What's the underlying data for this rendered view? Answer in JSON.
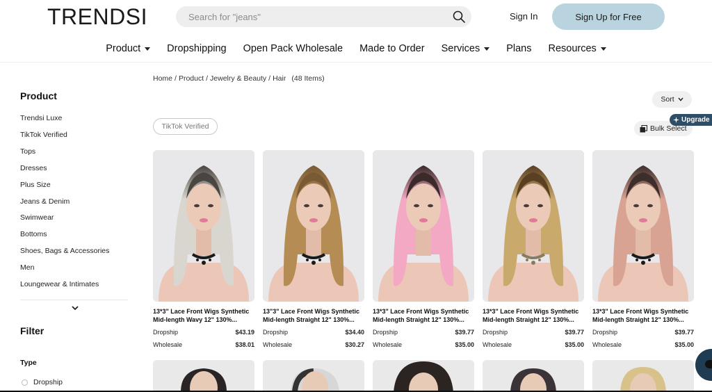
{
  "header": {
    "logo": "TRENDSI",
    "search_placeholder": "Search for \"jeans\"",
    "sign_in": "Sign In",
    "sign_up": "Sign Up for Free"
  },
  "nav": [
    {
      "label": "Product",
      "dropdown": true
    },
    {
      "label": "Dropshipping",
      "dropdown": false
    },
    {
      "label": "Open Pack Wholesale",
      "dropdown": false
    },
    {
      "label": "Made to Order",
      "dropdown": false
    },
    {
      "label": "Services",
      "dropdown": true
    },
    {
      "label": "Plans",
      "dropdown": false
    },
    {
      "label": "Resources",
      "dropdown": true
    }
  ],
  "sidebar": {
    "title": "Product",
    "items": [
      "Trendsi Luxe",
      "TikTok Verified",
      "Tops",
      "Dresses",
      "Plus Size",
      "Jeans & Denim",
      "Swimwear",
      "Bottoms",
      "Shoes, Bags & Accessories",
      "Men",
      "Loungewear & Intimates"
    ],
    "filter_title": "Filter",
    "type_title": "Type",
    "type_option": "Dropship"
  },
  "breadcrumb": {
    "items": [
      "Home",
      "Product",
      "Jewelry & Beauty",
      "Hair"
    ],
    "count": "(48 Items)"
  },
  "toolbar": {
    "sort": "Sort",
    "tiktok_chip": "TikTok Verified",
    "bulk_select": "Bulk Select",
    "upgrade": "Upgrade"
  },
  "products": [
    {
      "title": "13*3\" Lace Front Wigs Synthetic Mid-length Wavy 12\" 130%...",
      "dropship_label": "Dropship",
      "dropship_price": "$43.19",
      "wholesale_label": "Wholesale",
      "wholesale_price": "$38.01",
      "hair_color": "#d9d6cf",
      "root_color": "#4a4540",
      "choker": "#1a1a1a"
    },
    {
      "title": "13\"3\" Lace Front Wigs Synthetic Mid-length Straight 12\" 130%...",
      "dropship_label": "Dropship",
      "dropship_price": "$34.40",
      "wholesale_label": "Wholesale",
      "wholesale_price": "$30.27",
      "hair_color": "#b68c55",
      "root_color": "#7a5a34",
      "choker": "#1a1a1a"
    },
    {
      "title": "13*3\" Lace Front Wigs Synthetic Mid-length Straight 12\" 130%...",
      "dropship_label": "Dropship",
      "dropship_price": "$39.77",
      "wholesale_label": "Wholesale",
      "wholesale_price": "$35.00",
      "hair_color": "#f3a9c3",
      "root_color": "#3a2a2a",
      "choker": ""
    },
    {
      "title": "13*3\" Lace Front Wigs Synthetic Mid-length Straight 12\" 130%...",
      "dropship_label": "Dropship",
      "dropship_price": "$39.77",
      "wholesale_label": "Wholesale",
      "wholesale_price": "$35.00",
      "hair_color": "#c9a96c",
      "root_color": "#5a4023",
      "choker": "#8a7a60"
    },
    {
      "title": "13*3\" Lace Front Wigs Synthetic Mid-length Straight 12\" 130%...",
      "dropship_label": "Dropship",
      "dropship_price": "$39.77",
      "wholesale_label": "Wholesale",
      "wholesale_price": "$35.00",
      "hair_color": "#d8a393",
      "root_color": "#3c2e2a",
      "choker": "#1a1a1a"
    }
  ]
}
